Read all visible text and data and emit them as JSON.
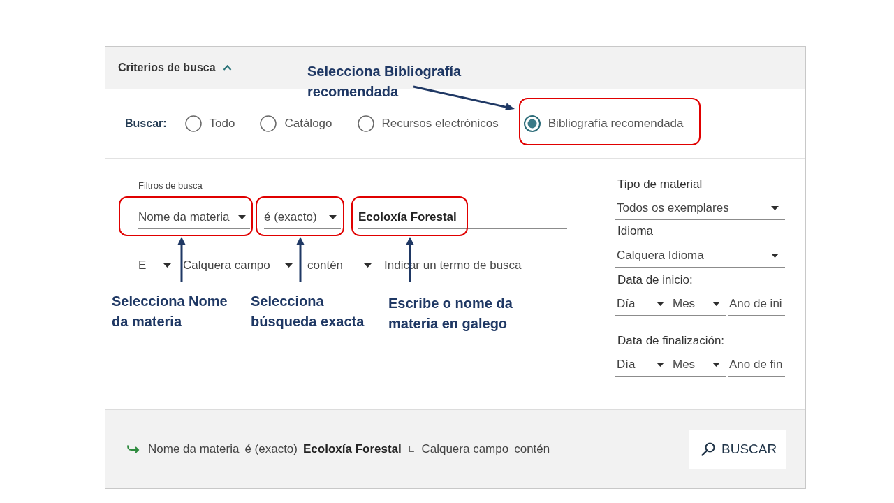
{
  "panel": {
    "header": {
      "title": "Criterios de busca",
      "expanded": true
    },
    "search_scope": {
      "label": "Buscar:",
      "options": [
        {
          "label": "Todo",
          "selected": false
        },
        {
          "label": "Catálogo",
          "selected": false
        },
        {
          "label": "Recursos electrónicos",
          "selected": false
        },
        {
          "label": "Bibliografía recomendada",
          "selected": true
        }
      ]
    },
    "filters": {
      "label": "Filtros de busca",
      "rows": [
        {
          "fields": [
            {
              "kind": "select",
              "value": "Nome da materia"
            },
            {
              "kind": "select",
              "value": "é (exacto)"
            },
            {
              "kind": "input",
              "value": "Ecoloxía Forestal"
            }
          ]
        },
        {
          "fields": [
            {
              "kind": "select",
              "value": "E"
            },
            {
              "kind": "select",
              "value": "Calquera campo"
            },
            {
              "kind": "select",
              "value": "contén"
            },
            {
              "kind": "input",
              "placeholder": "Indicar un termo de busca"
            }
          ]
        }
      ]
    },
    "side_filters": [
      {
        "label": "Tipo de material",
        "fields": [
          {
            "kind": "select",
            "value": "Todos os exemplares"
          }
        ]
      },
      {
        "label": "Idioma",
        "fields": [
          {
            "kind": "select",
            "value": "Calquera Idioma"
          }
        ]
      },
      {
        "label": "Data de inicio:",
        "fields": [
          {
            "kind": "select",
            "value": "Día"
          },
          {
            "kind": "select",
            "value": "Mes"
          },
          {
            "kind": "input",
            "placeholder": "Ano de ini"
          }
        ]
      },
      {
        "label": "Data de finalización:",
        "fields": [
          {
            "kind": "select",
            "value": "Día"
          },
          {
            "kind": "select",
            "value": "Mes"
          },
          {
            "kind": "input",
            "placeholder": "Ano de fin"
          }
        ]
      }
    ],
    "query_summary": [
      {
        "kind": "field",
        "text": "Nome da materia"
      },
      {
        "kind": "operator",
        "text": "é (exacto)"
      },
      {
        "kind": "term",
        "text": "Ecoloxía Forestal"
      },
      {
        "kind": "connector",
        "text": "E"
      },
      {
        "kind": "field",
        "text": "Calquera campo"
      },
      {
        "kind": "operator",
        "text": "contén"
      },
      {
        "kind": "blank"
      }
    ],
    "search_button": {
      "label": "BUSCAR"
    }
  },
  "annotations": [
    {
      "text": "Selecciona Bibliografía\nrecomendada"
    },
    {
      "text": "Selecciona Nome\nda materia"
    },
    {
      "text": "Selecciona\nbúsqueda exacta"
    },
    {
      "text": "Escribe o nome da\nmateria en galego"
    }
  ]
}
